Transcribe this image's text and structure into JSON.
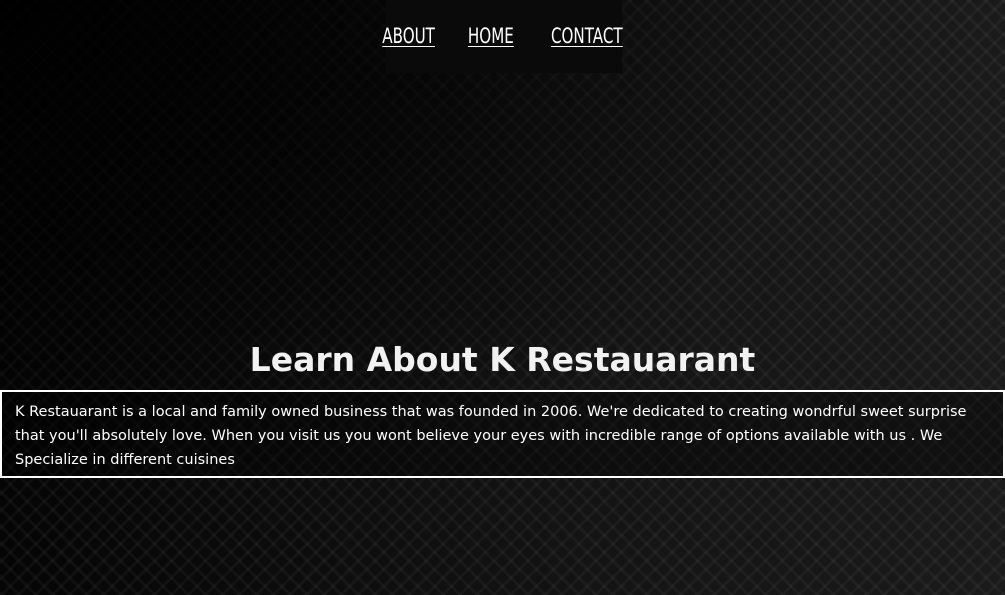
{
  "nav": {
    "items": [
      {
        "label": "ABOUT"
      },
      {
        "label": "HOME"
      },
      {
        "label": "CONTACT"
      }
    ]
  },
  "main": {
    "heading": "Learn About K Restauarant",
    "description": "K Restauarant is a local and family owned business that was founded in 2006. We're dedicated to creating wondrful sweet surprise that you'll absolutely love. When you visit us you wont believe your eyes with incredible range of options available with us . We Specialize in different cuisines"
  },
  "colors": {
    "background": "#0d0d0d",
    "text": "#ffffff",
    "box_border": "#ffffff"
  }
}
